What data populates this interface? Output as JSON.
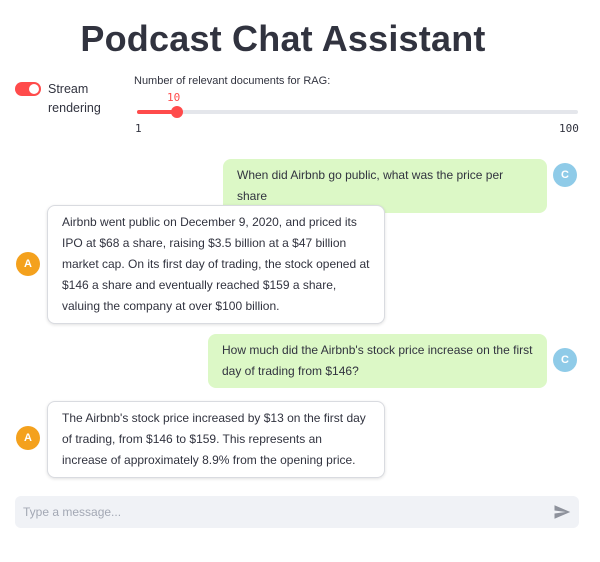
{
  "header": {
    "title": "Podcast Chat Assistant"
  },
  "controls": {
    "stream_toggle": {
      "label": "Stream rendering",
      "on": true
    },
    "slider": {
      "label": "Number of relevant documents for RAG:",
      "value": "10",
      "min": "1",
      "max": "100",
      "value_fraction": 0.09
    }
  },
  "chat": {
    "messages": [
      {
        "role": "user",
        "avatar": "C",
        "text": "When did Airbnb go public, what was the price per share"
      },
      {
        "role": "assistant",
        "avatar": "A",
        "text": "Airbnb went public on December 9, 2020, and priced its IPO at $68 a share, raising $3.5 billion at a $47 billion market cap. On its first day of trading, the stock opened at $146 a share and eventually reached $159 a share, valuing the company at over $100 billion."
      },
      {
        "role": "user",
        "avatar": "C",
        "text": "How much did the Airbnb's stock price increase on the first day of trading from $146?"
      },
      {
        "role": "assistant",
        "avatar": "A",
        "text": "The Airbnb's stock price increased by $13 on the first day of trading, from $146 to $159. This represents an increase of approximately 8.9% from the opening price."
      }
    ]
  },
  "input": {
    "placeholder": "Type a message...",
    "value": "",
    "send_icon": "send-icon"
  },
  "colors": {
    "accent": "#ff4b4b",
    "user_bubble": "#dcf8c6",
    "user_avatar": "#8fcbe8",
    "assistant_avatar": "#f4a11d"
  }
}
